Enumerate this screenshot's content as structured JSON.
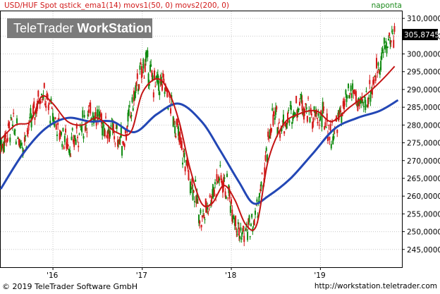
{
  "header": {
    "instrument": "USD/HUF Spot qstick_ema1(14) movs1(50, 0) movs2(200, 0)",
    "status": "naponta"
  },
  "logo": {
    "part1": "TeleTrader ",
    "part2": "WorkStation"
  },
  "footer": {
    "copyright": "© 2019 TeleTrader Software GmbH",
    "url": "http://workstation.teletrader.com"
  },
  "colors": {
    "candle_up": "#0f8a0f",
    "candle_down": "#d41818",
    "ema": "#c41414",
    "ma200": "#2347b5",
    "grid": "#c8c8c8",
    "last_value_box": "#000000"
  },
  "chart_data": {
    "type": "candlestick",
    "title": "",
    "y_axis": {
      "position": "right",
      "ylim": [
        240000,
        312000
      ],
      "ticks": [
        "245,0000",
        "250,0000",
        "255,0000",
        "260,0000",
        "265,0000",
        "270,0000",
        "275,0000",
        "280,0000",
        "285,0000",
        "290,0000",
        "295,0000",
        "300,0000",
        "305,0000",
        "310,0000"
      ]
    },
    "x_axis": {
      "ticks": [
        "'16",
        "'17",
        "'18",
        "'19"
      ],
      "tick_dates": [
        "2016-01",
        "2017-01",
        "2018-01",
        "2019-01"
      ],
      "range": [
        "2015-06",
        "2019-12"
      ]
    },
    "last_value": "305,8745",
    "grid": true,
    "series": [
      {
        "name": "qstick_ema1(14)",
        "style": "line",
        "color": "#c41414"
      },
      {
        "name": "movs2(200, 0)",
        "style": "line",
        "color": "#2347b5"
      },
      {
        "name": "movs1(50, 0)",
        "style": "line",
        "color": "#c41414"
      }
    ],
    "price_path": [
      [
        "2015-06-01",
        274000
      ],
      [
        "2015-07-15",
        280000
      ],
      [
        "2015-09-01",
        275000
      ],
      [
        "2015-10-15",
        283000
      ],
      [
        "2015-11-15",
        290000
      ],
      [
        "2015-12-15",
        285000
      ],
      [
        "2016-02-01",
        278000
      ],
      [
        "2016-03-15",
        274000
      ],
      [
        "2016-05-01",
        280000
      ],
      [
        "2016-06-15",
        284000
      ],
      [
        "2016-07-15",
        281000
      ],
      [
        "2016-09-01",
        278000
      ],
      [
        "2016-10-15",
        275000
      ],
      [
        "2016-12-15",
        292000
      ],
      [
        "2017-01-15",
        298000
      ],
      [
        "2017-02-15",
        292000
      ],
      [
        "2017-04-01",
        291000
      ],
      [
        "2017-05-01",
        285000
      ],
      [
        "2017-06-15",
        272000
      ],
      [
        "2017-08-01",
        262000
      ],
      [
        "2017-09-01",
        253000
      ],
      [
        "2017-10-15",
        261000
      ],
      [
        "2017-11-15",
        266000
      ],
      [
        "2017-12-15",
        262000
      ],
      [
        "2018-01-15",
        255000
      ],
      [
        "2018-02-01",
        250000
      ],
      [
        "2018-02-15",
        249000
      ],
      [
        "2018-04-01",
        252000
      ],
      [
        "2018-05-15",
        265000
      ],
      [
        "2018-06-15",
        282000
      ],
      [
        "2018-08-01",
        280000
      ],
      [
        "2018-09-01",
        283000
      ],
      [
        "2018-10-15",
        287000
      ],
      [
        "2018-12-01",
        282000
      ],
      [
        "2019-01-15",
        282000
      ],
      [
        "2019-02-15",
        277000
      ],
      [
        "2019-04-01",
        284000
      ],
      [
        "2019-05-15",
        290000
      ],
      [
        "2019-06-15",
        284000
      ],
      [
        "2019-08-01",
        291000
      ],
      [
        "2019-09-01",
        298000
      ],
      [
        "2019-10-01",
        303000
      ],
      [
        "2019-11-01",
        305800
      ]
    ],
    "ma200_path": [
      [
        "2015-06-01",
        262000
      ],
      [
        "2015-09-01",
        272000
      ],
      [
        "2015-12-01",
        279000
      ],
      [
        "2016-03-01",
        282000
      ],
      [
        "2016-06-01",
        281000
      ],
      [
        "2016-09-01",
        281000
      ],
      [
        "2016-12-01",
        278000
      ],
      [
        "2017-03-01",
        283000
      ],
      [
        "2017-06-01",
        286000
      ],
      [
        "2017-09-01",
        281000
      ],
      [
        "2017-11-15",
        273000
      ],
      [
        "2018-02-01",
        264000
      ],
      [
        "2018-04-01",
        258000
      ],
      [
        "2018-06-01",
        260000
      ],
      [
        "2018-09-01",
        265000
      ],
      [
        "2018-12-01",
        272000
      ],
      [
        "2019-03-01",
        279000
      ],
      [
        "2019-06-01",
        282000
      ],
      [
        "2019-09-01",
        284000
      ],
      [
        "2019-11-15",
        287000
      ]
    ],
    "ema_path": [
      [
        "2015-06-01",
        276000
      ],
      [
        "2015-08-01",
        280000
      ],
      [
        "2015-10-01",
        281000
      ],
      [
        "2015-11-15",
        288000
      ],
      [
        "2016-01-01",
        286000
      ],
      [
        "2016-03-01",
        281000
      ],
      [
        "2016-05-01",
        280000
      ],
      [
        "2016-07-01",
        282000
      ],
      [
        "2016-09-15",
        278000
      ],
      [
        "2016-11-15",
        278000
      ],
      [
        "2017-01-01",
        289000
      ],
      [
        "2017-03-01",
        293000
      ],
      [
        "2017-04-15",
        290000
      ],
      [
        "2017-06-01",
        281000
      ],
      [
        "2017-07-15",
        268000
      ],
      [
        "2017-09-01",
        258000
      ],
      [
        "2017-10-15",
        258000
      ],
      [
        "2017-12-01",
        263000
      ],
      [
        "2018-01-15",
        259000
      ],
      [
        "2018-03-01",
        252000
      ],
      [
        "2018-04-15",
        252000
      ],
      [
        "2018-06-01",
        270000
      ],
      [
        "2018-08-01",
        280000
      ],
      [
        "2018-10-01",
        283000
      ],
      [
        "2018-12-15",
        284000
      ],
      [
        "2019-02-15",
        281000
      ],
      [
        "2019-05-01",
        285000
      ],
      [
        "2019-07-15",
        289000
      ],
      [
        "2019-09-15",
        293000
      ],
      [
        "2019-11-01",
        296500
      ]
    ]
  }
}
